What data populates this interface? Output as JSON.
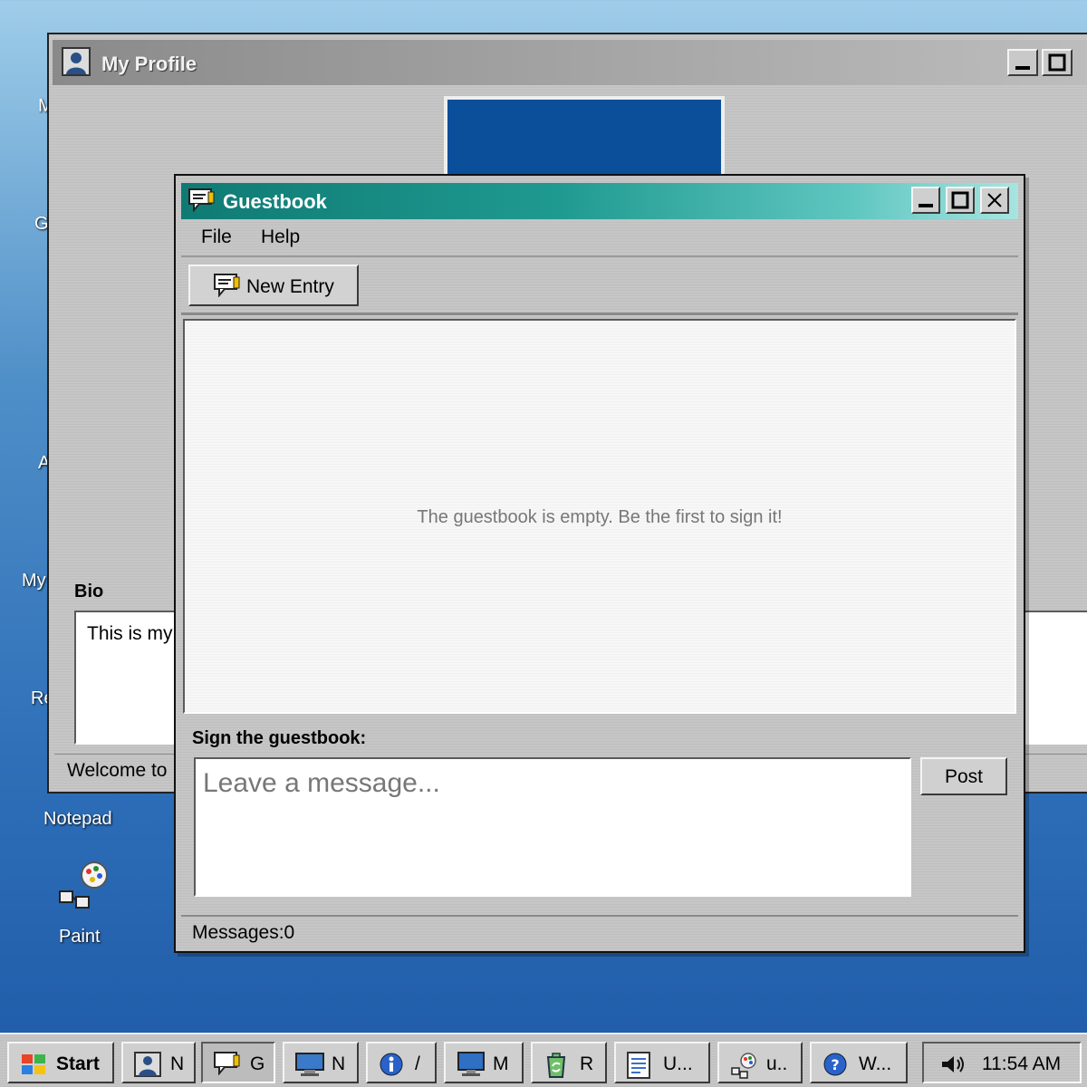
{
  "desktop": {
    "notepad_label": "Notepad",
    "paint_label": "Paint",
    "partial_labels": [
      "M",
      "G",
      "A",
      "My",
      "Re"
    ]
  },
  "profile_window": {
    "title": "My Profile",
    "bio_label": "Bio",
    "bio_text": "This is my",
    "status_text": "Welcome to"
  },
  "guestbook": {
    "title": "Guestbook",
    "menu": [
      "File",
      "Help"
    ],
    "toolbar": {
      "new_entry_label": "New Entry"
    },
    "empty_message": "The guestbook is empty. Be the first to sign it!",
    "sign_label": "Sign the guestbook:",
    "message_placeholder": "Leave a message...",
    "post_label": "Post",
    "status": "Messages:0"
  },
  "taskbar": {
    "start_label": "Start",
    "tasks": [
      {
        "label": "N",
        "icon": "profile-icon"
      },
      {
        "label": "G",
        "icon": "guestbook-icon",
        "active": true
      },
      {
        "label": "N",
        "icon": "display-icon"
      },
      {
        "label": "/",
        "icon": "info-icon"
      },
      {
        "label": "M",
        "icon": "computer-icon"
      },
      {
        "label": "R",
        "icon": "recycle-icon"
      },
      {
        "label": "U...",
        "icon": "notepad-icon"
      },
      {
        "label": "u..",
        "icon": "paint-icon"
      },
      {
        "label": "W...",
        "icon": "help-icon"
      }
    ],
    "clock": "11:54 AM"
  },
  "colors": {
    "guestbook_title_start": "#0f7a74",
    "guestbook_title_end": "#a8e4e0",
    "avatar_blue": "#0b4f9b",
    "window_gray": "#c6c6c6"
  }
}
